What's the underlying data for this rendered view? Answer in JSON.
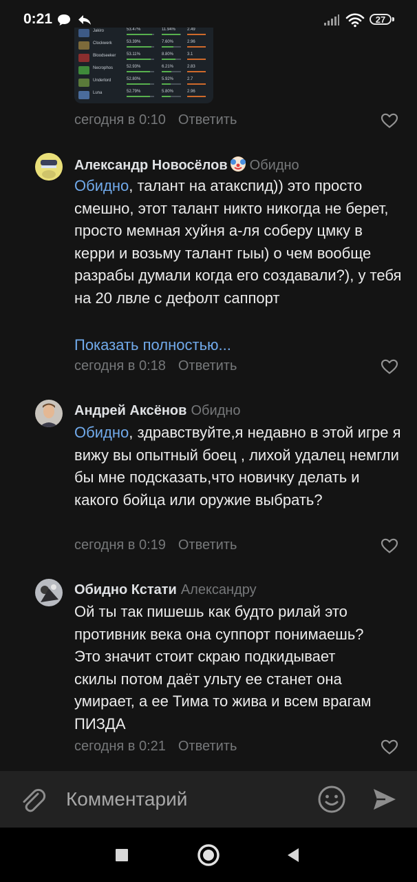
{
  "status_bar": {
    "time": "0:21",
    "battery": "27"
  },
  "attachment": {
    "heroes": [
      {
        "name": "Jakiro",
        "win": "53.47%",
        "pick": "11.94%",
        "kda": "2.49",
        "win_frac": 0.92,
        "pick_frac": 0.95
      },
      {
        "name": "Clockwerk",
        "win": "53.39%",
        "pick": "7.60%",
        "kda": "2.96",
        "win_frac": 0.9,
        "pick_frac": 0.6
      },
      {
        "name": "Bloodseeker",
        "win": "53.11%",
        "pick": "8.80%",
        "kda": "3.1",
        "win_frac": 0.88,
        "pick_frac": 0.7
      },
      {
        "name": "Necrophos",
        "win": "52.93%",
        "pick": "6.21%",
        "kda": "2.83",
        "win_frac": 0.86,
        "pick_frac": 0.5
      },
      {
        "name": "Underlord",
        "win": "52.80%",
        "pick": "5.92%",
        "kda": "2.7",
        "win_frac": 0.85,
        "pick_frac": 0.47
      },
      {
        "name": "Luna",
        "win": "52.79%",
        "pick": "5.80%",
        "kda": "2.96",
        "win_frac": 0.85,
        "pick_frac": 0.46
      }
    ]
  },
  "comments": [
    {
      "meta": "сегодня в 0:10",
      "reply_label": "Ответить"
    },
    {
      "author": "Александр Новосёлов",
      "reply_to": "Обидно",
      "mention": "Обидно",
      "text": ", талант на атакспид)) это просто смешно, этот талант никто никогда не берет, просто мемная хуйня а-ля соберу цмку в керри и возьму талант гыы) о чем вообще разрабы думали когда его создавали?), у тебя на 20 лвле с дефолт саппорт",
      "show_more": "Показать полностью...",
      "meta": "сегодня в 0:18",
      "reply_label": "Ответить"
    },
    {
      "author": "Андрей Аксёнов",
      "reply_to": "Обидно",
      "mention": "Обидно",
      "text": ", здравствуйте,я недавно в этой игре я вижу вы опытный боец , лихой удалец немгли бы мне подсказать,что новичку делать и какого бойца или оружие выбрать?",
      "meta": "сегодня в 0:19",
      "reply_label": "Ответить"
    },
    {
      "author": "Обидно Кстати",
      "reply_to": "Александру",
      "text": "Ой ты так пишешь как будто рилай это противник века она суппорт понимаешь? Это значит стоит скраю подкидывает скилы потом даёт ульту ее станет она умирает, а ее Тима то жива и всем врагам ПИЗДА",
      "meta": "сегодня в 0:21",
      "reply_label": "Ответить"
    }
  ],
  "composer": {
    "placeholder": "Комментарий"
  },
  "colors": {
    "background": "#141414",
    "link": "#71aaeb",
    "muted": "#76787a"
  }
}
